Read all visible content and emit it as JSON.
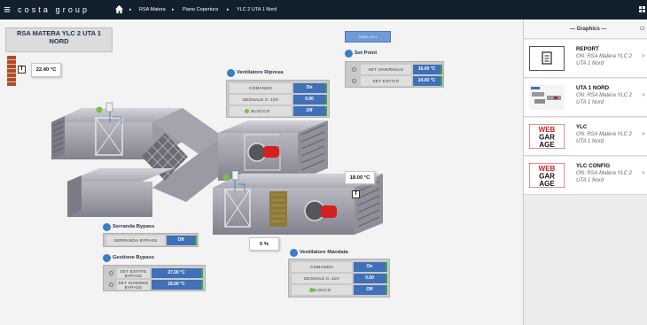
{
  "topbar": {
    "logo": "costa group",
    "breadcrumb": [
      "RSA Matera",
      "Piano Copertura",
      "YLC 2 UTA 1 Nord"
    ]
  },
  "plant": {
    "title": "RSA MATERA YLC 2 UTA 1 NORD",
    "top_button": "PIANO UTA 1",
    "temp_outdoor": "22.40 °C",
    "temp_supply": "18.00 °C",
    "damper_percent": "0 %",
    "t_symbol": "T"
  },
  "ventilatore_ripresa": {
    "title": "Ventilatore Ripresa",
    "rows": [
      {
        "label": "COMANDO",
        "value": "On"
      },
      {
        "label": "SEGNALE 0..10V",
        "value": "0.00"
      },
      {
        "label": "BLOCCO",
        "value": "Off"
      }
    ]
  },
  "set_point": {
    "title": "Set Point",
    "rows": [
      {
        "label": "SET INVERNALE",
        "value": "16.00 °C"
      },
      {
        "label": "SET ESTIVO",
        "value": "24.00 °C"
      }
    ]
  },
  "serranda_bypass": {
    "title": "Serranda Bypass",
    "rows": [
      {
        "label": "SERRANDA BYPASS",
        "value": "Off"
      }
    ]
  },
  "gestione_bypass": {
    "title": "Gestione Bypass",
    "rows": [
      {
        "label": "SET ESTATE BYPASS",
        "label1": "SET ESTATE",
        "label2": "BYPASS",
        "value": "27.00 °C"
      },
      {
        "label": "SET INVERNO BYPASS",
        "label1": "SET INVERNO",
        "label2": "BYPASS",
        "value": "18.00 °C"
      }
    ]
  },
  "ventilatore_mandata": {
    "title": "Ventilatore Mandata",
    "rows": [
      {
        "label": "COMANDO",
        "value": "On"
      },
      {
        "label": "SEGNALE 0..10V",
        "value": "0.00"
      },
      {
        "label": "BLOCCO",
        "value": "Off"
      }
    ]
  },
  "sidebar": {
    "title": "— Graphics —",
    "corner": "Cl",
    "items": [
      {
        "name": "REPORT",
        "sub": "ON: RSA Matera YLC 2 UTA 1 Nord",
        "icon": "report-icon"
      },
      {
        "name": "UTA 1 NORD",
        "sub": "ON: RSA Matera YLC 2 UTA 1 Nord",
        "icon": "uta-thumbnail"
      },
      {
        "name": "YLC",
        "sub": "ON: RSA Matera YLC 2 UTA 1 Nord",
        "icon": "webgarage-logo"
      },
      {
        "name": "YLC CONFIG",
        "sub": "ON: RSA Matera YLC 2 UTA 1 Nord",
        "icon": "webgarage-logo"
      }
    ],
    "arrow": ">"
  },
  "logo_letters": [
    "WEB",
    "GAR",
    "AGE"
  ],
  "colors": {
    "topbar": "#12202e",
    "value_blue": "#3f70b8",
    "status_green": "#77c043",
    "fan_red": "#d42020"
  }
}
